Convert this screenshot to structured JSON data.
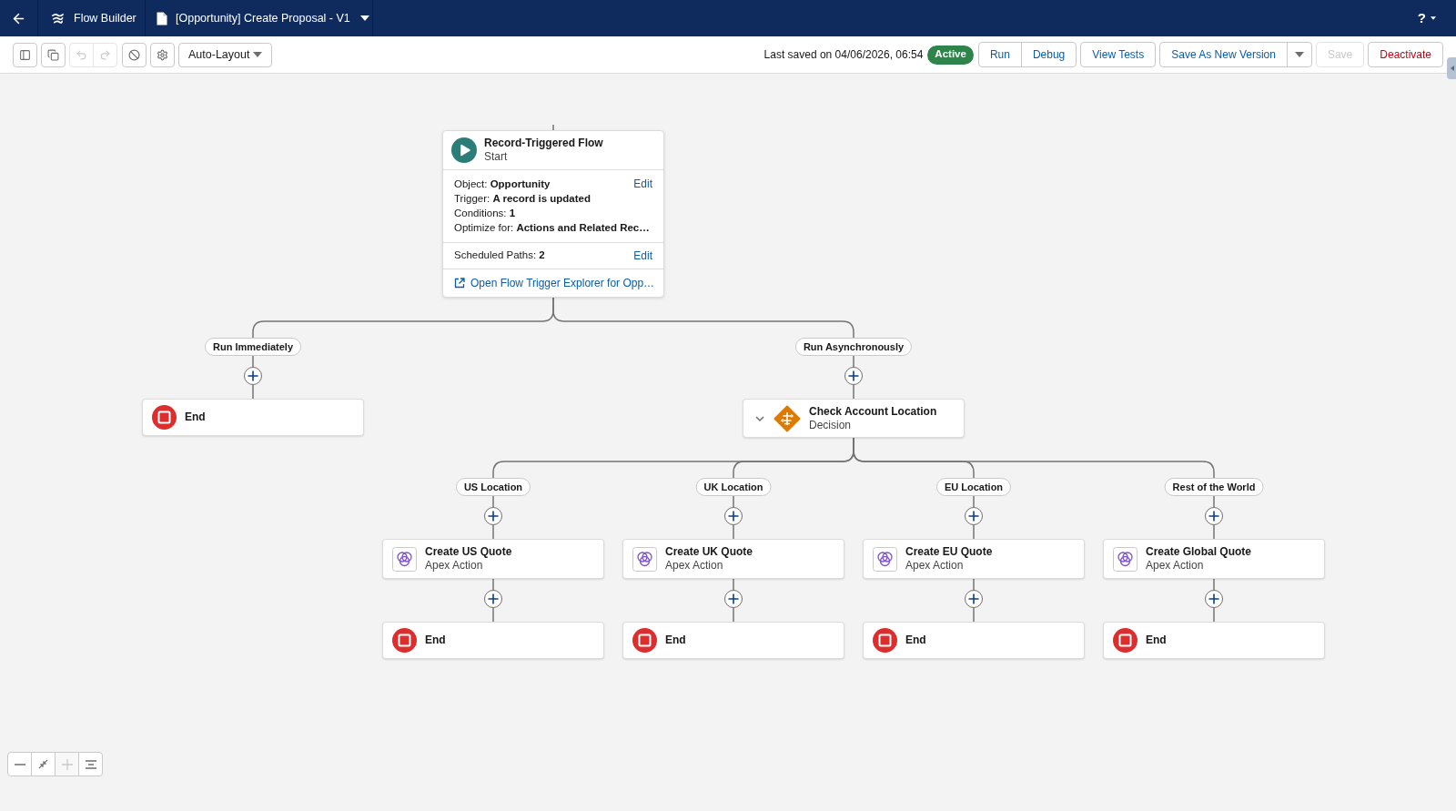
{
  "top_bar": {
    "app_name": "Flow Builder",
    "document_title": "[Opportunity] Create Proposal - V1",
    "help_label": "?"
  },
  "toolbar": {
    "undo": {
      "disabled": true
    },
    "redo": {
      "disabled": true
    },
    "layout_mode": "Auto-Layout",
    "last_saved": "Last saved on 04/06/2026, 06:54",
    "status": "Active",
    "button_groups": [
      {
        "menu": false,
        "buttons": [
          {
            "label": "Run",
            "kind": "brand",
            "disabled": false
          },
          {
            "label": "Debug",
            "kind": "brand",
            "disabled": false
          }
        ]
      },
      {
        "menu": false,
        "buttons": [
          {
            "label": "View Tests",
            "kind": "brand",
            "disabled": false
          }
        ]
      },
      {
        "menu": true,
        "buttons": [
          {
            "label": "Save As New Version",
            "kind": "brand",
            "disabled": false
          }
        ]
      },
      {
        "menu": false,
        "buttons": [
          {
            "label": "Save",
            "kind": "brand",
            "disabled": true
          }
        ]
      },
      {
        "menu": false,
        "buttons": [
          {
            "label": "Deactivate",
            "kind": "destructive",
            "disabled": false
          }
        ]
      }
    ]
  },
  "canvas": {
    "start": {
      "title": "Record-Triggered Flow",
      "subtitle": "Start",
      "details": [
        "Object: **Opportunity**",
        "Trigger: **A record is updated**",
        "Conditions: **1**",
        "Optimize for: **Actions and Related Rec…**"
      ],
      "details_action": "Edit",
      "scheduled_paths": "Scheduled Paths: **2**",
      "scheduled_paths_action": "Edit",
      "explorer_link": "Open Flow Trigger Explorer for Opp…"
    },
    "paths": [
      {
        "label": "Run Immediately",
        "elements": [
          {
            "kind": "end",
            "label": "End"
          }
        ]
      },
      {
        "label": "Run Asynchronously",
        "elements": [
          {
            "kind": "decision",
            "label": "Check Account Location",
            "type": "Decision",
            "expanded": true,
            "outcomes": [
              {
                "label": "US Location",
                "elements": [
                  {
                    "kind": "action",
                    "label": "Create US Quote",
                    "type": "Apex Action"
                  },
                  {
                    "kind": "end",
                    "label": "End"
                  }
                ]
              },
              {
                "label": "UK Location",
                "elements": [
                  {
                    "kind": "action",
                    "label": "Create UK Quote",
                    "type": "Apex Action"
                  },
                  {
                    "kind": "end",
                    "label": "End"
                  }
                ]
              },
              {
                "label": "EU Location",
                "elements": [
                  {
                    "kind": "action",
                    "label": "Create EU Quote",
                    "type": "Apex Action"
                  },
                  {
                    "kind": "end",
                    "label": "End"
                  }
                ]
              },
              {
                "label": "Rest of the World",
                "elements": [
                  {
                    "kind": "action",
                    "label": "Create Global Quote",
                    "type": "Apex Action"
                  },
                  {
                    "kind": "end",
                    "label": "End"
                  }
                ]
              }
            ]
          }
        ]
      }
    ]
  },
  "zoom_controls": {
    "zoom_out": {
      "disabled": false
    },
    "fit": {
      "disabled": false
    },
    "zoom_in": {
      "disabled": true
    },
    "center": {
      "disabled": false
    }
  }
}
